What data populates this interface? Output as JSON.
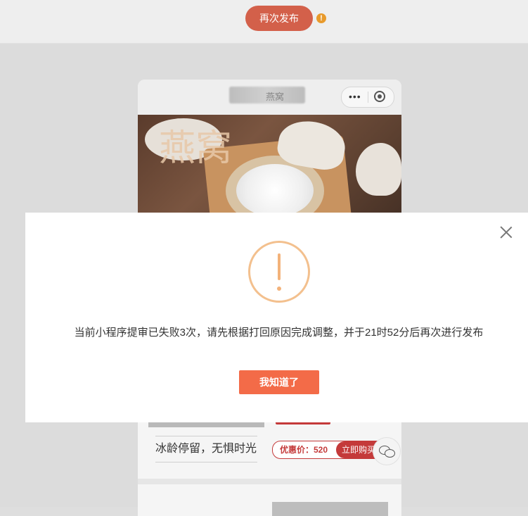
{
  "topbar": {
    "republish_label": "再次发布",
    "warning_badge": "!"
  },
  "preview": {
    "nav_title": "燕窝",
    "capsule_dots": "•••",
    "banner_calligraphy": "燕窝",
    "product_title": "冰龄停留，无惧时光",
    "price_label": "优惠价：520",
    "buy_label": "立即购买"
  },
  "dialog": {
    "message": "当前小程序提审已失败3次，请先根据打回原因完成调整，并于21时52分后再次进行发布",
    "confirm_label": "我知道了"
  },
  "colors": {
    "accent": "#f36b48",
    "republish": "#d3604a",
    "warning": "#f3c08e",
    "price_red": "#c43a3a"
  }
}
